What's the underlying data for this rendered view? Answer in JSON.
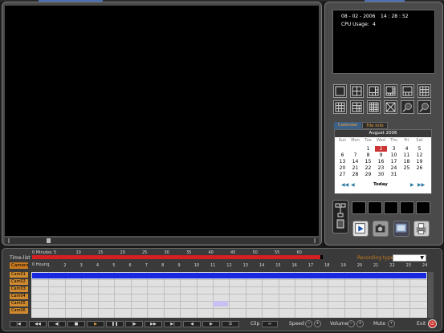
{
  "status": {
    "date": "08 - 02 - 2006",
    "time": "14 : 28 : 52",
    "cpu_label": "CPU Usage:",
    "cpu_value": "4"
  },
  "tabs": {
    "calendar": "Calendar",
    "file_info": "File Info"
  },
  "calendar": {
    "month_title": "August 2006",
    "day_names": [
      "Sun",
      "Mon",
      "Tue",
      "Wed",
      "Thu",
      "Fri",
      "Sat"
    ],
    "weeks": [
      [
        "",
        "",
        "1",
        "2",
        "3",
        "4",
        "5"
      ],
      [
        "6",
        "7",
        "8",
        "9",
        "10",
        "11",
        "12"
      ],
      [
        "13",
        "14",
        "15",
        "16",
        "17",
        "18",
        "19"
      ],
      [
        "20",
        "21",
        "22",
        "23",
        "24",
        "25",
        "26"
      ],
      [
        "27",
        "28",
        "29",
        "30",
        "31",
        "",
        ""
      ]
    ],
    "selected_day": "2",
    "today_label": "Today"
  },
  "timeline": {
    "time_list_label": "Time-list",
    "camera_tab_label": "Camera",
    "minutes_label": "0 Minutes",
    "hours_label": "0 Hours",
    "minute_ticks": [
      "5",
      "10",
      "15",
      "20",
      "25",
      "30",
      "35",
      "40",
      "45",
      "50",
      "55",
      "60"
    ],
    "hour_ticks": [
      "1",
      "2",
      "3",
      "4",
      "5",
      "6",
      "7",
      "8",
      "9",
      "10",
      "11",
      "12",
      "13",
      "14",
      "15",
      "16",
      "17",
      "18",
      "19",
      "20",
      "21",
      "22",
      "23",
      "24"
    ],
    "recording_type_label": "Recording type",
    "recording_type_value": "",
    "cameras": [
      "Cam01",
      "Cam02",
      "Cam03",
      "Cam04",
      "Cam05",
      "Cam06"
    ]
  },
  "controls": {
    "clip_label": "Clip",
    "speed_label": "Speed",
    "volume_label": "Volume",
    "mute_label": "Mute",
    "exit_label": "Exit"
  },
  "colors": {
    "accent_orange": "#c97a1f",
    "record_red": "#d42020",
    "record_blue": "#1828e0",
    "calendar_tab_blue": "#3c5f86"
  }
}
